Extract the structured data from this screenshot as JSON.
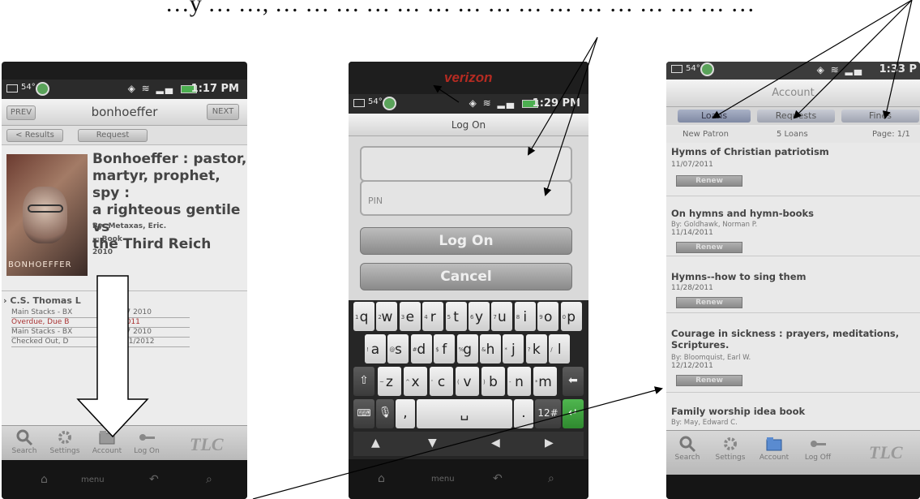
{
  "caption": {
    "text": "…y … …, … … … … … … … … … … … … … … … …"
  },
  "phone1": {
    "status": {
      "temp": "54°",
      "time": "1:17 PM"
    },
    "title": "bonhoeffer",
    "prev_label": "PREV",
    "next_label": "NEXT",
    "results_label": "< Results",
    "request_label": "Request",
    "book": {
      "cover_text": "BONHOEFFER",
      "title_lines": [
        "Bonhoeffer : pastor,",
        "martyr, prophet, spy :",
        "a righteous gentile vs",
        "the Third Reich"
      ],
      "author": "By: Metaxas, Eric.",
      "format": "Book",
      "year": "2010"
    },
    "holdings": {
      "library": "C.S. Thomas L",
      "rows": [
        {
          "location": "Main Stacks - BX",
          "call": "M47 2010"
        },
        {
          "location": "Overdue, Due B",
          "call": "2011"
        },
        {
          "location": "Main Stacks - BX",
          "call": "M47 2010"
        },
        {
          "location": "Checked Out, D",
          "call": "/11/2012"
        }
      ]
    },
    "tabs": [
      "Search",
      "Settings",
      "Account",
      "Log On"
    ],
    "brand": "TLC",
    "nav": [
      "⌂",
      "menu",
      "↶",
      "⌕"
    ]
  },
  "phone2": {
    "carrier": "verizon",
    "status": {
      "temp": "54°",
      "time": "1:29 PM"
    },
    "title": "Log On",
    "pin_placeholder": "PIN",
    "logon_button": "Log On",
    "cancel_button": "Cancel",
    "keyboard": {
      "row1": [
        [
          "1",
          "q"
        ],
        [
          "2",
          "w"
        ],
        [
          "3",
          "e"
        ],
        [
          "4",
          "r"
        ],
        [
          "5",
          "t"
        ],
        [
          "6",
          "y"
        ],
        [
          "7",
          "u"
        ],
        [
          "8",
          "i"
        ],
        [
          "9",
          "o"
        ],
        [
          "0",
          "p"
        ]
      ],
      "row2": [
        [
          "!",
          "a"
        ],
        [
          "@",
          "s"
        ],
        [
          "#",
          "d"
        ],
        [
          "$",
          "f"
        ],
        [
          "%",
          "g"
        ],
        [
          "&",
          "h"
        ],
        [
          "*",
          "j"
        ],
        [
          "?",
          "k"
        ],
        [
          "/",
          "l"
        ]
      ],
      "row3": [
        [
          "~",
          "z"
        ],
        [
          "^",
          "x"
        ],
        [
          "'",
          "c"
        ],
        [
          "(",
          "v"
        ],
        [
          ")",
          "b"
        ],
        [
          "-",
          "n"
        ],
        [
          "*",
          "m"
        ]
      ],
      "symbols_label": "12#"
    },
    "nav": [
      "⌂",
      "menu",
      "↶",
      "⌕"
    ]
  },
  "phone3": {
    "status": {
      "temp": "54°",
      "time": "1:33 P"
    },
    "title": "Account",
    "subtabs": [
      "Loans",
      "Requests",
      "Fines"
    ],
    "info": {
      "patron": "New Patron",
      "loans": "5 Loans",
      "page": "Page: 1/1"
    },
    "renew_label": "Renew",
    "loans": [
      {
        "title": "Hymns of Christian patriotism",
        "author": "",
        "date": "11/07/2011"
      },
      {
        "title": "On hymns and hymn-books",
        "author": "By: Goldhawk, Norman P.",
        "date": "11/14/2011"
      },
      {
        "title": "Hymns--how to sing them",
        "author": "",
        "date": "11/28/2011"
      },
      {
        "title": "Courage in sickness : prayers, meditations,",
        "title2": "Scriptures.",
        "author": "By: Bloomquist, Earl W.",
        "date": "12/12/2011"
      },
      {
        "title": "Family worship idea book",
        "author": "By: May, Edward C.",
        "date": ""
      }
    ],
    "tabs": [
      "Search",
      "Settings",
      "Account",
      "Log Off"
    ],
    "brand": "TLC"
  }
}
